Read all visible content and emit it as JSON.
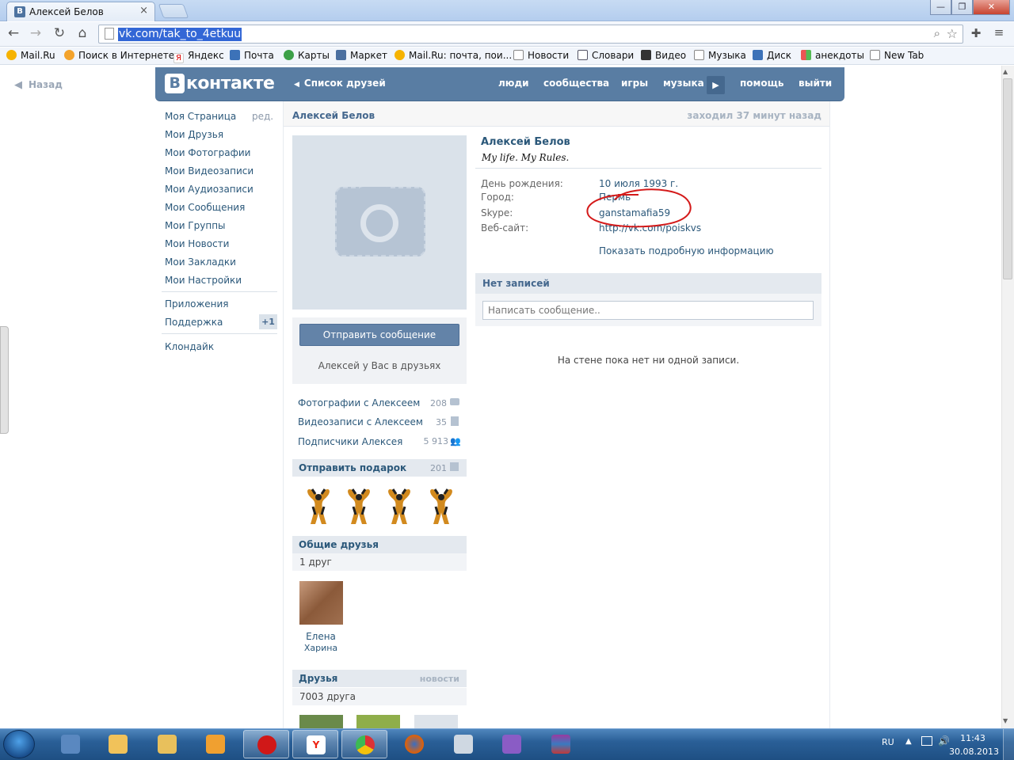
{
  "browser": {
    "tab_title": "Алексей Белов",
    "url": "vk.com/tak_to_4etkuu",
    "bookmarks": [
      "Mail.Ru",
      "Поиск в Интернете",
      "Яндекс",
      "Почта",
      "Карты",
      "Маркет",
      "Mail.Ru: почта, пои...",
      "Новости",
      "Словари",
      "Видео",
      "Музыка",
      "Диск",
      "анекдоты",
      "New Tab"
    ]
  },
  "page": {
    "back": "Назад",
    "header": {
      "logo": "контакте",
      "logo_letter": "В",
      "friends_list": "Список друзей",
      "nav": [
        "люди",
        "сообщества",
        "игры",
        "музыка",
        "помощь",
        "выйти"
      ]
    },
    "left_nav": {
      "items": [
        "Моя Страница",
        "Мои Друзья",
        "Мои Фотографии",
        "Мои Видеозаписи",
        "Мои Аудиозаписи",
        "Мои Сообщения",
        "Мои Группы",
        "Мои Новости",
        "Мои Закладки",
        "Мои Настройки"
      ],
      "edit": "ред.",
      "apps": "Приложения",
      "support": "Поддержка",
      "support_badge": "+1",
      "klondike": "Клондайк"
    },
    "profile": {
      "header_name": "Алексей Белов",
      "last_seen": "заходил 37 минут назад",
      "name": "Алексей Белов",
      "status": "My life. My Rules.",
      "send_message": "Отправить сообщение",
      "friend_note": "Алексей у Вас в друзьях",
      "info": [
        {
          "label": "День рождения:",
          "value": "10 июля 1993 г."
        },
        {
          "label": "Город:",
          "value": "Пермь"
        },
        {
          "label": "Skype:",
          "value": "ganstamafia59"
        },
        {
          "label": "Веб-сайт:",
          "value": "http://vk.com/poiskvs"
        }
      ],
      "more_info": "Показать подробную информацию",
      "links": [
        {
          "label": "Фотографии с Алексеем",
          "count": "208"
        },
        {
          "label": "Видеозаписи с Алексеем",
          "count": "35"
        },
        {
          "label": "Подписчики Алексея",
          "count": "5 913"
        }
      ],
      "gifts_title": "Отправить подарок",
      "gifts_count": "201",
      "mutual_title": "Общие друзья",
      "mutual_count": "1 друг",
      "mutual_friend_first": "Елена",
      "mutual_friend_last": "Харина",
      "friends_title": "Друзья",
      "friends_news": "новости",
      "friends_count": "7003 друга"
    },
    "wall": {
      "title": "Нет записей",
      "placeholder": "Написать сообщение..",
      "empty": "На стене пока нет ни одной записи."
    }
  },
  "taskbar": {
    "lang": "RU",
    "time": "11:43",
    "date": "30.08.2013"
  }
}
